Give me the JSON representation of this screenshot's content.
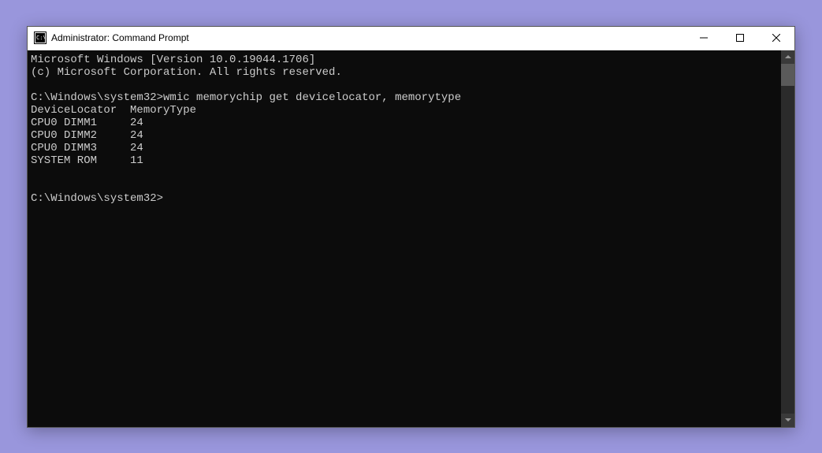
{
  "window": {
    "title": "Administrator: Command Prompt"
  },
  "console": {
    "line1": "Microsoft Windows [Version 10.0.19044.1706]",
    "line2": "(c) Microsoft Corporation. All rights reserved.",
    "blank1": "",
    "prompt1_path": "C:\\Windows\\system32>",
    "prompt1_cmd": "wmic memorychip get devicelocator, memorytype",
    "header": "DeviceLocator  MemoryType",
    "row1": "CPU0 DIMM1     24",
    "row2": "CPU0 DIMM2     24",
    "row3": "CPU0 DIMM3     24",
    "row4": "SYSTEM ROM     11",
    "blank2": "",
    "blank3": "",
    "prompt2": "C:\\Windows\\system32>"
  }
}
